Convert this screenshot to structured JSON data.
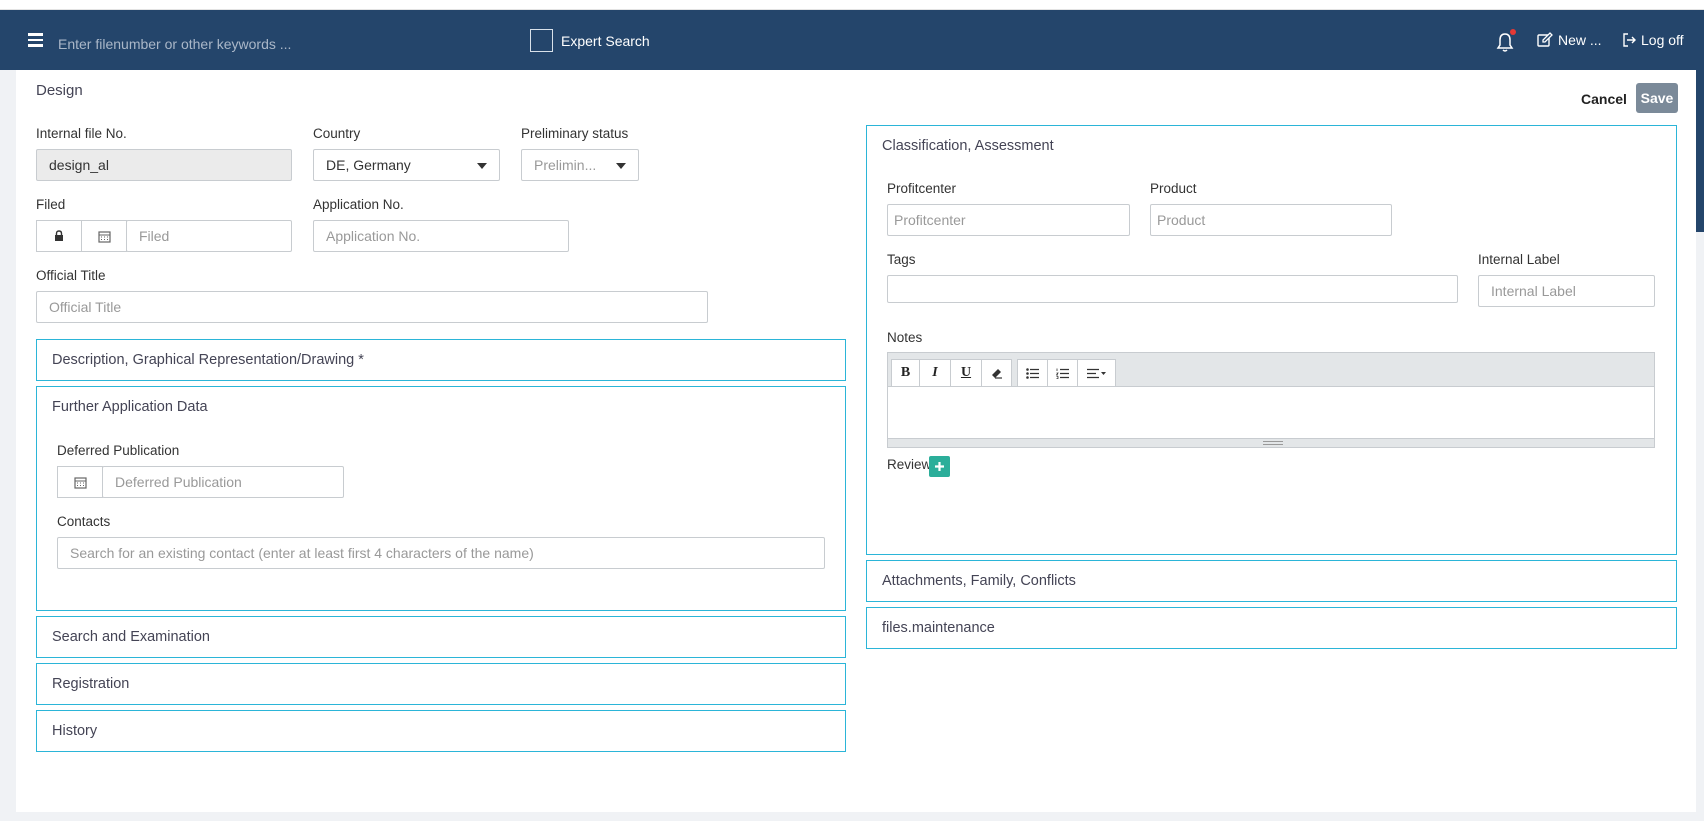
{
  "navbar": {
    "search_placeholder": "Enter filenumber or other keywords ...",
    "expert_search": "Expert Search",
    "new_label": "New ...",
    "logoff_label": "Log off"
  },
  "page": {
    "title": "Design",
    "cancel": "Cancel",
    "save": "Save"
  },
  "form": {
    "internal_file_no": {
      "label": "Internal file No.",
      "value": "design_al"
    },
    "country": {
      "label": "Country",
      "value": "DE, Germany"
    },
    "preliminary_status": {
      "label": "Preliminary status",
      "value": "Prelimin..."
    },
    "filed": {
      "label": "Filed",
      "placeholder": "Filed"
    },
    "application_no": {
      "label": "Application No.",
      "placeholder": "Application No."
    },
    "official_title": {
      "label": "Official Title",
      "placeholder": "Official Title"
    }
  },
  "panels": {
    "description": "Description, Graphical Representation/Drawing *",
    "further": {
      "title": "Further Application Data",
      "deferred_label": "Deferred Publication",
      "deferred_placeholder": "Deferred Publication",
      "contacts_label": "Contacts",
      "contacts_placeholder": "Search for an existing contact (enter at least first 4 characters of the name)"
    },
    "search_exam": "Search and Examination",
    "registration": "Registration",
    "history": "History",
    "classification": {
      "title": "Classification, Assessment",
      "profitcenter_label": "Profitcenter",
      "profitcenter_placeholder": "Profitcenter",
      "product_label": "Product",
      "product_placeholder": "Product",
      "tags_label": "Tags",
      "internal_label_label": "Internal Label",
      "internal_label_placeholder": "Internal Label",
      "notes_label": "Notes",
      "review_label": "Review"
    },
    "attachments": "Attachments, Family, Conflicts",
    "maintenance": "files.maintenance"
  },
  "editor": {
    "bold": "B",
    "italic": "I",
    "underline": "U"
  },
  "colors": {
    "navbar": "#24456b",
    "panel_border": "#2bb5d8",
    "save_button": "#7b8a99",
    "review_add": "#2bae9a"
  }
}
